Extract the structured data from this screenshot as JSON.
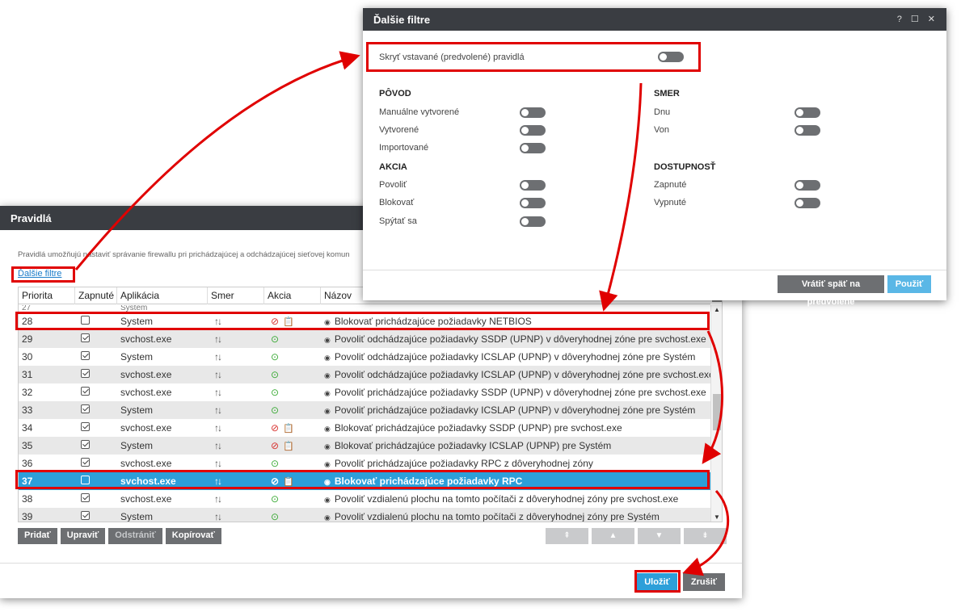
{
  "rules": {
    "title": "Pravidlá",
    "description": "Pravidlá umožňujú nastaviť správanie firewallu pri prichádzajúcej a odchádzajúcej sieťovej komun",
    "more_filters_link": "Ďalšie filtre",
    "columns": [
      "Priorita",
      "Zapnuté",
      "Aplikácia",
      "Smer",
      "Akcia",
      "Názov"
    ],
    "partial_row": {
      "priority": "27",
      "app": "System"
    },
    "rows": [
      {
        "priority": "28",
        "enabled": false,
        "app": "System",
        "dir": "↑↓",
        "action": "block",
        "name": "Blokovať prichádzajúce požiadavky NETBIOS"
      },
      {
        "priority": "29",
        "enabled": true,
        "app": "svchost.exe",
        "dir": "↑↓",
        "action": "allow",
        "name": "Povoliť odchádzajúce požiadavky SSDP (UPNP) v dôveryhodnej zóne pre svchost.exe"
      },
      {
        "priority": "30",
        "enabled": true,
        "app": "System",
        "dir": "↑↓",
        "action": "allow",
        "name": "Povoliť odchádzajúce požiadavky ICSLAP (UPNP) v dôveryhodnej zóne pre Systém"
      },
      {
        "priority": "31",
        "enabled": true,
        "app": "svchost.exe",
        "dir": "↑↓",
        "action": "allow",
        "name": "Povoliť odchádzajúce požiadavky ICSLAP (UPNP) v dôveryhodnej zóne pre svchost.exe"
      },
      {
        "priority": "32",
        "enabled": true,
        "app": "svchost.exe",
        "dir": "↑↓",
        "action": "allow",
        "name": "Povoliť prichádzajúce požiadavky SSDP (UPNP) v dôveryhodnej zóne pre svchost.exe"
      },
      {
        "priority": "33",
        "enabled": true,
        "app": "System",
        "dir": "↑↓",
        "action": "allow",
        "name": "Povoliť prichádzajúce požiadavky ICSLAP (UPNP) v dôveryhodnej zóne pre Systém"
      },
      {
        "priority": "34",
        "enabled": true,
        "app": "svchost.exe",
        "dir": "↑↓",
        "action": "block",
        "name": "Blokovať prichádzajúce požiadavky SSDP (UPNP) pre svchost.exe"
      },
      {
        "priority": "35",
        "enabled": true,
        "app": "System",
        "dir": "↑↓",
        "action": "block",
        "name": "Blokovať prichádzajúce požiadavky ICSLAP (UPNP) pre Systém"
      },
      {
        "priority": "36",
        "enabled": true,
        "app": "svchost.exe",
        "dir": "↑↓",
        "action": "allow",
        "name": "Povoliť prichádzajúce požiadavky RPC z dôveryhodnej zóny"
      },
      {
        "priority": "37",
        "enabled": false,
        "app": "svchost.exe",
        "dir": "↑↓",
        "action": "block",
        "name": "Blokovať prichádzajúce požiadavky RPC",
        "selected": true
      },
      {
        "priority": "38",
        "enabled": true,
        "app": "svchost.exe",
        "dir": "↑↓",
        "action": "allow",
        "name": "Povoliť vzdialenú plochu na tomto počítači z dôveryhodnej zóny pre svchost.exe"
      },
      {
        "priority": "39",
        "enabled": true,
        "app": "System",
        "dir": "↑↓",
        "action": "allow",
        "name": "Povoliť vzdialenú plochu na tomto počítači z dôveryhodnej zóny pre Systém"
      }
    ],
    "buttons": {
      "add": "Pridať",
      "edit": "Upraviť",
      "remove": "Odstrániť",
      "copy": "Kopírovať"
    },
    "move_buttons": [
      "⇞",
      "▲",
      "▼",
      "⇟"
    ],
    "save": "Uložiť",
    "cancel": "Zrušiť"
  },
  "filters": {
    "title": "Ďalšie filtre",
    "window_controls": "? ☐ ✕",
    "hide_builtin": "Skryť vstavané (predvolené) pravidlá",
    "origin": {
      "heading": "PÔVOD",
      "items": [
        "Manuálne vytvorené",
        "Vytvorené",
        "Importované"
      ]
    },
    "action": {
      "heading": "AKCIA",
      "items": [
        "Povoliť",
        "Blokovať",
        "Spýtať sa"
      ]
    },
    "direction": {
      "heading": "SMER",
      "items": [
        "Dnu",
        "Von"
      ]
    },
    "availability": {
      "heading": "DOSTUPNOSŤ",
      "items": [
        "Zapnuté",
        "Vypnuté"
      ]
    },
    "reset": "Vrátiť späť na predvolené",
    "apply": "Použiť"
  },
  "colors": {
    "accent": "#2d9fd9",
    "titlebar": "#3a3d42",
    "highlight": "#e00000",
    "allow": "#3aaa35",
    "block": "#d8322f"
  }
}
